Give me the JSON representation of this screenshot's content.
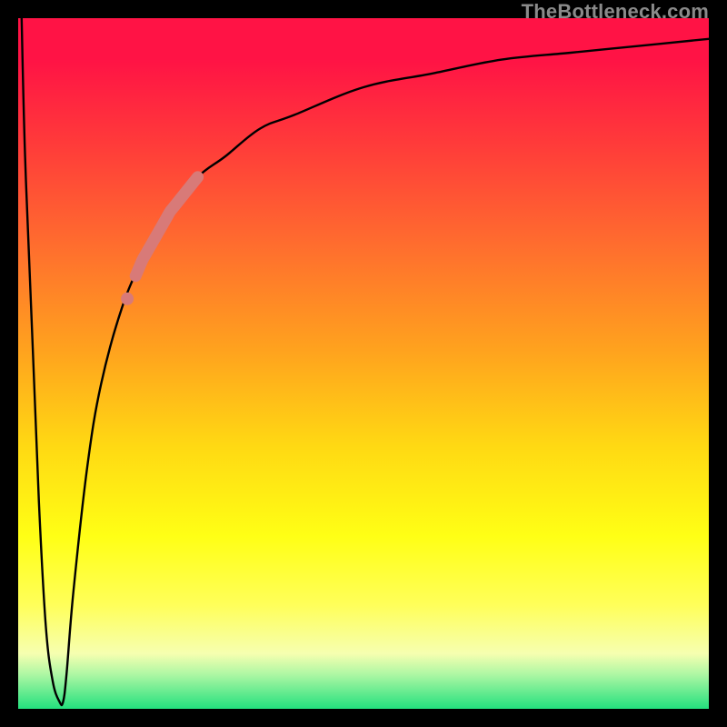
{
  "attribution": "TheBottleneck.com",
  "colors": {
    "frame": "#000000",
    "gradient_top": "#ff1345",
    "gradient_mid1": "#ff6a2f",
    "gradient_mid2": "#ffd913",
    "gradient_mid3": "#ffff15",
    "gradient_bottom": "#23e07e",
    "curve": "#000000",
    "highlight": "#d87a78"
  },
  "chart_data": {
    "type": "line",
    "title": "",
    "xlabel": "",
    "ylabel": "",
    "xlim": [
      0,
      100
    ],
    "ylim": [
      0,
      100
    ],
    "grid": false,
    "legend": false,
    "series": [
      {
        "name": "bottleneck-curve",
        "x": [
          0.5,
          1,
          2,
          3,
          4,
          5,
          6,
          6.5,
          7,
          8,
          10,
          12,
          15,
          18,
          22,
          26,
          30,
          35,
          40,
          50,
          60,
          70,
          80,
          90,
          100
        ],
        "y": [
          100,
          80,
          55,
          30,
          12,
          4,
          1,
          1,
          5,
          17,
          35,
          47,
          58,
          65,
          72,
          77,
          80,
          84,
          86,
          90,
          92,
          94,
          95,
          96,
          97
        ]
      }
    ],
    "highlight_segment": {
      "series": "bottleneck-curve",
      "x_start": 17,
      "x_end": 26,
      "note": "thick pink emphasis on rising limb"
    },
    "minimum": {
      "x": 6.3,
      "y": 1
    }
  }
}
